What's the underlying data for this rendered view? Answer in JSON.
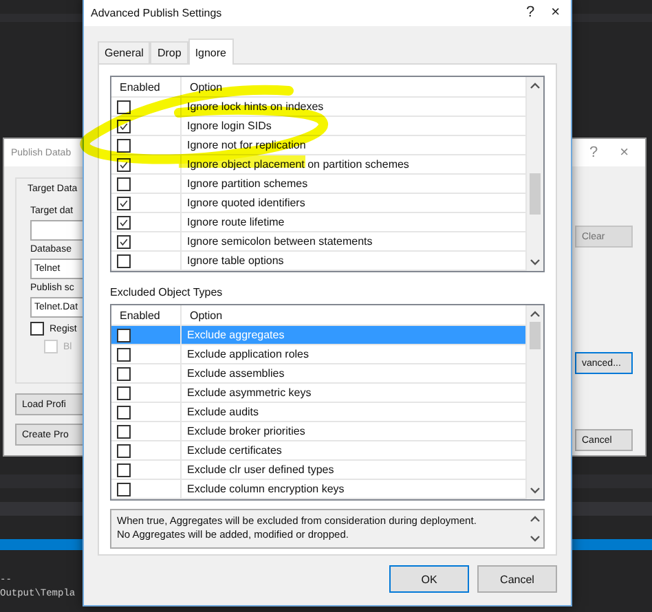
{
  "editor_output": {
    "lines": [
      "--",
      "Output\\Templa"
    ]
  },
  "publish_dialog": {
    "title": "Publish Datab",
    "help": "?",
    "close": "×",
    "group_label": "Target Data",
    "target_label": "Target dat",
    "database_label": "Database",
    "database_value": "Telnet",
    "script_label": "Publish sc",
    "script_value": "Telnet.Dat",
    "checkboxes": [
      {
        "label": "Regist",
        "checked": false,
        "disabled": false
      },
      {
        "label": "Bl",
        "checked": false,
        "disabled": true
      }
    ],
    "left_buttons": [
      {
        "label": "Load Profi"
      },
      {
        "label": "Create Pro"
      }
    ],
    "clear_button": {
      "label": "Clear",
      "disabled": true
    },
    "advanced_button": {
      "label": "vanced..."
    },
    "cancel_button": {
      "label": "Cancel"
    }
  },
  "advanced_dialog": {
    "title": "Advanced Publish Settings",
    "help": "?",
    "close": "×",
    "tabs": [
      {
        "label": "General",
        "selected": false
      },
      {
        "label": "Drop",
        "selected": false
      },
      {
        "label": "Ignore",
        "selected": true
      }
    ],
    "options_grid": {
      "columns": [
        "Enabled",
        "Option"
      ],
      "rows": [
        {
          "label": "Ignore lock hints on indexes",
          "checked": false
        },
        {
          "label": "Ignore login SIDs",
          "checked": true
        },
        {
          "label": "Ignore not for replication",
          "checked": false
        },
        {
          "label": "Ignore object placement on partition schemes",
          "checked": true
        },
        {
          "label": "Ignore partition schemes",
          "checked": false
        },
        {
          "label": "Ignore quoted identifiers",
          "checked": true
        },
        {
          "label": "Ignore route lifetime",
          "checked": true
        },
        {
          "label": "Ignore semicolon between statements",
          "checked": true
        },
        {
          "label": "Ignore table options",
          "checked": false
        }
      ]
    },
    "excluded_label": "Excluded Object Types",
    "excluded_grid": {
      "columns": [
        "Enabled",
        "Option"
      ],
      "rows": [
        {
          "label": "Exclude aggregates",
          "checked": false,
          "selected": true
        },
        {
          "label": "Exclude application roles",
          "checked": false,
          "selected": false
        },
        {
          "label": "Exclude assemblies",
          "checked": false,
          "selected": false
        },
        {
          "label": "Exclude asymmetric keys",
          "checked": false,
          "selected": false
        },
        {
          "label": "Exclude audits",
          "checked": false,
          "selected": false
        },
        {
          "label": "Exclude broker priorities",
          "checked": false,
          "selected": false
        },
        {
          "label": "Exclude certificates",
          "checked": false,
          "selected": false
        },
        {
          "label": "Exclude clr user defined types",
          "checked": false,
          "selected": false
        },
        {
          "label": "Exclude column encryption keys",
          "checked": false,
          "selected": false
        }
      ]
    },
    "description": "When true, Aggregates will be excluded from consideration during deployment.\nNo Aggregates will be added, modified or dropped.",
    "buttons": [
      {
        "label": "OK",
        "default": true
      },
      {
        "label": "Cancel",
        "default": false
      }
    ]
  }
}
